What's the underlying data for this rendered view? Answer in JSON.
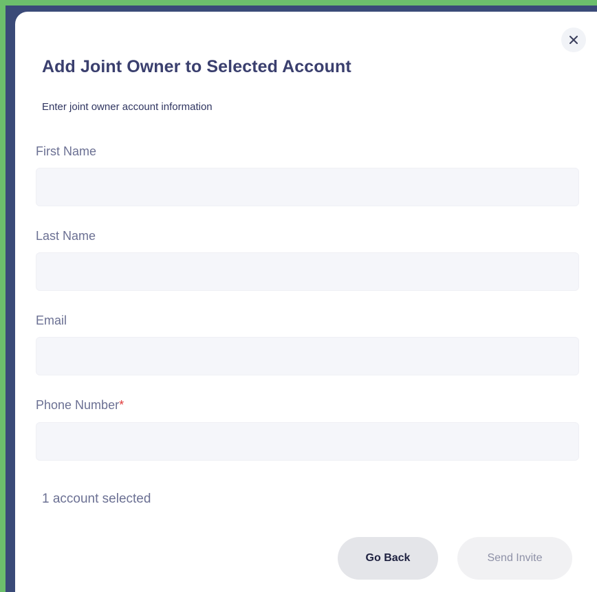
{
  "dialog": {
    "title": "Add Joint Owner to Selected Account",
    "subtitle": "Enter joint owner account information",
    "close_icon": "close-icon"
  },
  "fields": {
    "first_name": {
      "label": "First Name",
      "value": "",
      "placeholder": ""
    },
    "last_name": {
      "label": "Last Name",
      "value": "",
      "placeholder": ""
    },
    "email": {
      "label": "Email",
      "value": "",
      "placeholder": ""
    },
    "phone": {
      "label": "Phone Number",
      "required_marker": "*",
      "value": "",
      "placeholder": ""
    }
  },
  "status": {
    "selected_text": "1 account selected"
  },
  "actions": {
    "back_label": "Go Back",
    "send_label": "Send Invite"
  },
  "colors": {
    "frame_outline": "#6cbf6c",
    "backdrop": "#3a4a78",
    "title": "#3a3f6e",
    "label": "#6b7093",
    "required": "#e03a3a",
    "input_bg": "#f5f6fa"
  }
}
